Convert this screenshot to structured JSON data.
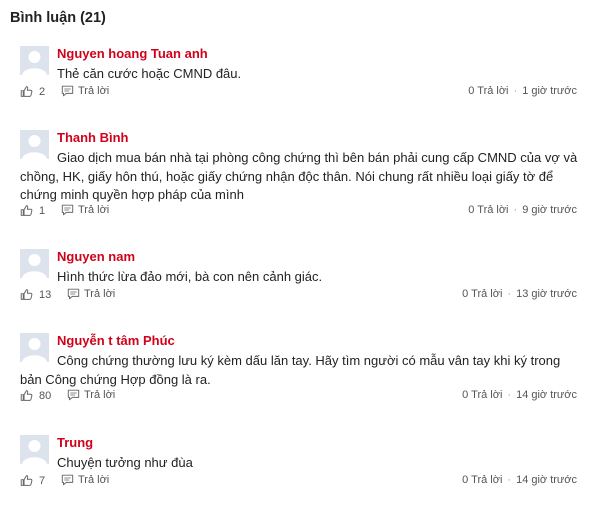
{
  "section_title": "Bình luận (21)",
  "comments": [
    {
      "author": "Nguyen hoang Tuan anh",
      "text": "Thẻ căn cước hoặc CMND đâu.",
      "likes": "2",
      "reply_label": "Trả lời",
      "reply_count": "0 Trả lời",
      "time": "1 giờ trước"
    },
    {
      "author": "Thanh Bình",
      "text": "Giao dịch mua bán nhà tại phòng công chứng thì bên bán phải cung cấp CMND của vợ và chồng, HK, giấy hôn thú, hoặc giấy chứng nhận độc thân. Nói chung rất nhiều loại giấy tờ để chứng minh quyền hợp pháp của mình",
      "likes": "1",
      "reply_label": "Trả lời",
      "reply_count": "0 Trả lời",
      "time": "9 giờ trước"
    },
    {
      "author": "Nguyen nam",
      "text": "Hình thức lừa đảo mới, bà con nên cảnh giác.",
      "likes": "13",
      "reply_label": "Trả lời",
      "reply_count": "0 Trả lời",
      "time": "13 giờ trước"
    },
    {
      "author": "Nguyễn t tâm Phúc",
      "text": "Công chứng thường lưu ký kèm dấu lăn tay. Hãy tìm người có mẫu vân tay khi ký trong bản Công chứng Hợp đồng là ra.",
      "likes": "80",
      "reply_label": "Trả lời",
      "reply_count": "0 Trả lời",
      "time": "14 giờ trước"
    },
    {
      "author": "Trung",
      "text": "Chuyện tưởng như đùa",
      "likes": "7",
      "reply_label": "Trả lời",
      "reply_count": "0 Trả lời",
      "time": "14 giờ trước"
    }
  ],
  "colors": {
    "author": "#d0021b",
    "text": "#222222",
    "meta": "#555555",
    "avatar_bg": "#dde3ec"
  },
  "icons": {
    "avatar": "user-silhouette-icon",
    "like": "thumbs-up-icon",
    "reply": "comment-bubble-icon"
  }
}
